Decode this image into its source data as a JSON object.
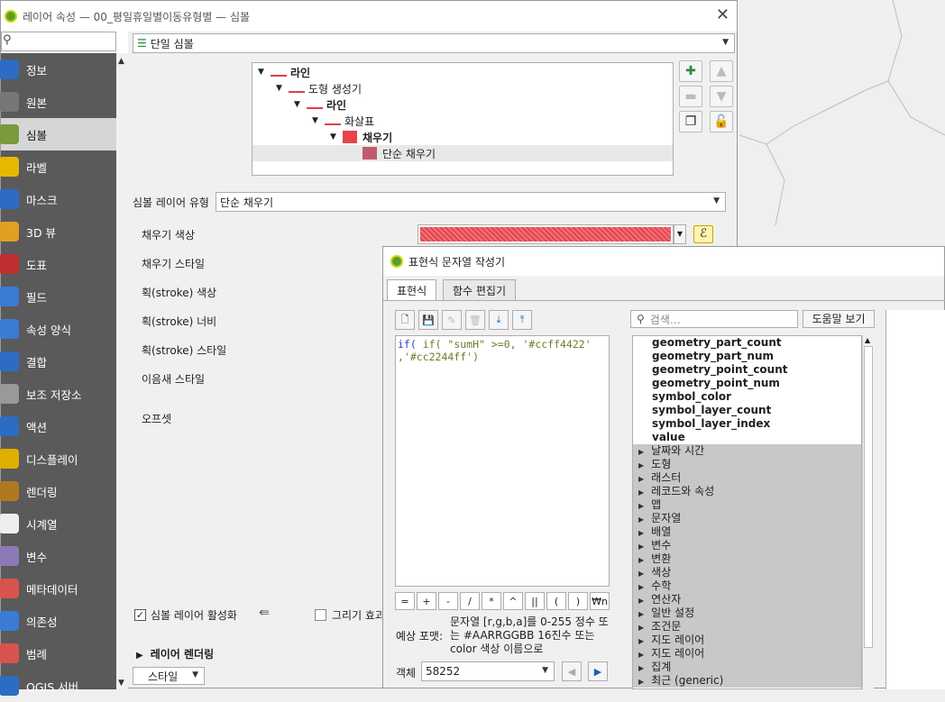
{
  "layer_props": {
    "title": "레이어 속성 — 00_평일휴일별이동유형별 — 심볼",
    "renderer_type": "단일 심볼",
    "sidebar": [
      {
        "label": "정보",
        "icon": "info-icon"
      },
      {
        "label": "원본",
        "icon": "source-icon"
      },
      {
        "label": "심볼",
        "icon": "symbology-icon"
      },
      {
        "label": "라벨",
        "icon": "labels-icon"
      },
      {
        "label": "마스크",
        "icon": "mask-icon"
      },
      {
        "label": "3D 뷰",
        "icon": "3d-view-icon"
      },
      {
        "label": "도표",
        "icon": "diagrams-icon"
      },
      {
        "label": "필드",
        "icon": "fields-icon"
      },
      {
        "label": "속성 양식",
        "icon": "attributes-form-icon"
      },
      {
        "label": "결합",
        "icon": "joins-icon"
      },
      {
        "label": "보조 저장소",
        "icon": "auxiliary-storage-icon"
      },
      {
        "label": "액션",
        "icon": "actions-icon"
      },
      {
        "label": "디스플레이",
        "icon": "display-icon"
      },
      {
        "label": "렌더링",
        "icon": "rendering-icon"
      },
      {
        "label": "시계열",
        "icon": "temporal-icon"
      },
      {
        "label": "변수",
        "icon": "variables-icon"
      },
      {
        "label": "메타데이터",
        "icon": "metadata-icon"
      },
      {
        "label": "의존성",
        "icon": "dependencies-icon"
      },
      {
        "label": "범례",
        "icon": "legend-icon"
      },
      {
        "label": "QGIS 서버",
        "icon": "qgis-server-icon"
      }
    ],
    "selected_sidebar": "심볼",
    "tree": [
      {
        "label": "라인",
        "bold": true
      },
      {
        "label": "도형 생성기",
        "bold": false
      },
      {
        "label": "라인",
        "bold": true
      },
      {
        "label": "화살표",
        "bold": false
      },
      {
        "label": "채우기",
        "bold": true
      },
      {
        "label": "단순 채우기",
        "bold": false
      }
    ],
    "symbol_layer_type_label": "심볼 레이어 유형",
    "symbol_layer_type_value": "단순 채우기",
    "properties": [
      "채우기 색상",
      "채우기 스타일",
      "획(stroke) 색상",
      "획(stroke) 너비",
      "획(stroke) 스타일",
      "이음새 스타일",
      "오프셋"
    ],
    "fill_color": "#e8434b",
    "enable_layer_label": "심볼 레이어 활성화",
    "draw_effects_label": "그리기 효과",
    "layer_rendering_label": "레이어 렌더링",
    "style_button": "스타일"
  },
  "expr_dialog": {
    "title": "표현식 문자열 작성기",
    "tabs": [
      "표현식",
      "함수 편집기"
    ],
    "expression_line1": "if( \"sumH\"  >=0, '#ccff4422'",
    "expression_line2": ",'#cc2244ff')",
    "operators": [
      "=",
      "+",
      "-",
      "/",
      "*",
      "^",
      "||",
      "(",
      ")",
      "₩n"
    ],
    "expected_format_label": "예상 포맷:",
    "expected_format_text": "문자열 [r,g,b,a]를 0-255 정수 또는 #AARRGGBB 16진수 또는 color 색상 이름으로",
    "feature_label": "객체",
    "feature_value": "58252",
    "search_placeholder": "검색…",
    "help_button": "도움말 보기",
    "functions": [
      "geometry_part_count",
      "geometry_part_num",
      "geometry_point_count",
      "geometry_point_num",
      "symbol_color",
      "symbol_layer_count",
      "symbol_layer_index",
      "value"
    ],
    "groups": [
      "날짜와 시간",
      "도형",
      "래스터",
      "레코드와 속성",
      "맵",
      "문자열",
      "배열",
      "변수",
      "변환",
      "색상",
      "수학",
      "연산자",
      "일반 설정",
      "조건문",
      "지도 레이어",
      "지도 레이어",
      "집계",
      "최근 (generic)"
    ]
  }
}
